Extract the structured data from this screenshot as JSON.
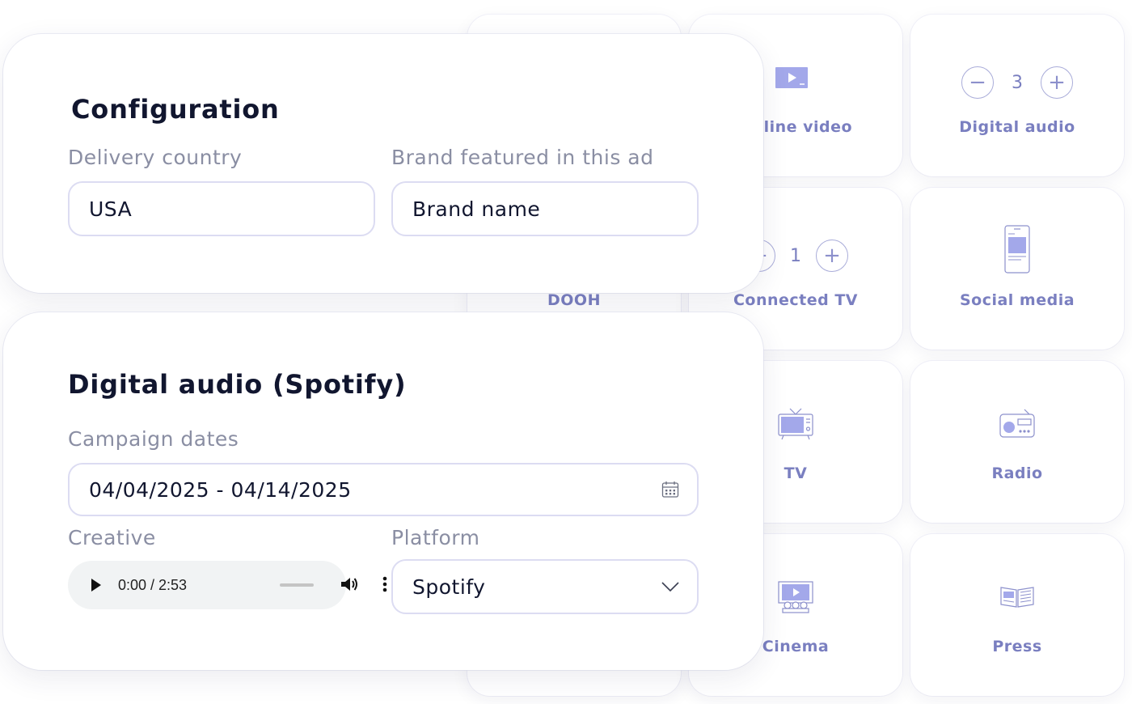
{
  "channels": [
    {
      "key": "dooh",
      "label": "DOOH",
      "icon": "billboard-icon"
    },
    {
      "key": "online-video",
      "label": "Online video",
      "icon": "video-player-icon"
    },
    {
      "key": "digital-audio",
      "label": "Digital audio",
      "counter": "3",
      "minus": "−",
      "plus": "+"
    },
    {
      "key": "connected-tv",
      "label": "Connected TV",
      "counter": "1",
      "minus": "−",
      "plus": "+"
    },
    {
      "key": "social-media",
      "label": "Social media",
      "icon": "smartphone-icon"
    },
    {
      "key": "tv",
      "label": "TV",
      "icon": "tv-icon"
    },
    {
      "key": "radio",
      "label": "Radio",
      "icon": "radio-icon"
    },
    {
      "key": "cinema",
      "label": "Cinema",
      "icon": "cinema-icon"
    },
    {
      "key": "press",
      "label": "Press",
      "icon": "newspaper-icon"
    }
  ],
  "configuration": {
    "title": "Configuration",
    "delivery_country_label": "Delivery country",
    "delivery_country_value": "USA",
    "brand_label": "Brand featured in this ad",
    "brand_value": "Brand name"
  },
  "digital_audio": {
    "title": "Digital audio (Spotify)",
    "dates_label": "Campaign dates",
    "dates_value": "04/04/2025 - 04/14/2025",
    "creative_label": "Creative",
    "audio_time": "0:00 / 2:53",
    "platform_label": "Platform",
    "platform_value": "Spotify"
  },
  "colors": {
    "accent": "#7a7fc0",
    "icon_fill": "#a3a8ea",
    "title_text": "#11162f",
    "muted_label": "#8a8ea3",
    "field_border": "#dcdcf2"
  }
}
